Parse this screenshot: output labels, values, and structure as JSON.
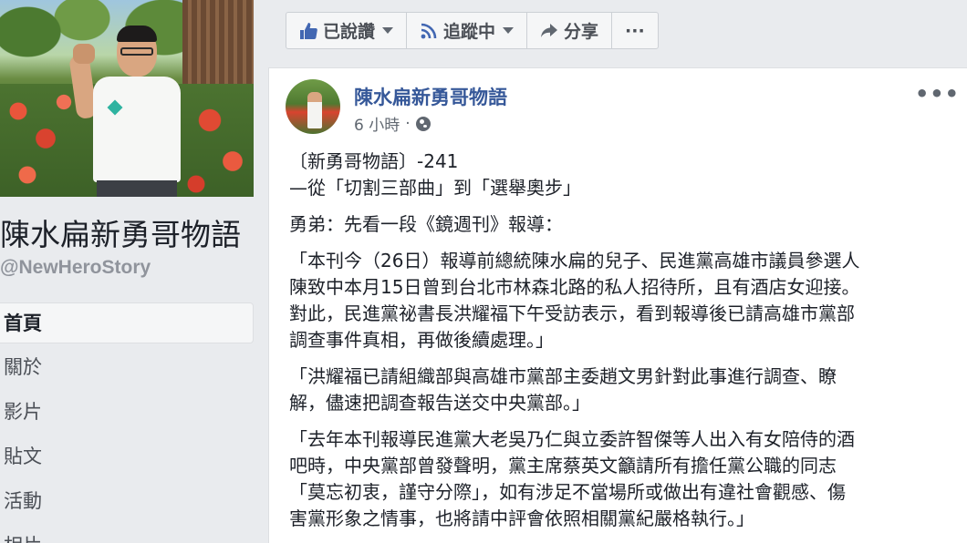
{
  "page": {
    "name": "陳水扁新勇哥物語",
    "handle": "@NewHeroStory"
  },
  "nav": {
    "items": [
      {
        "label": "首頁",
        "active": true
      },
      {
        "label": "關於",
        "active": false
      },
      {
        "label": "影片",
        "active": false
      },
      {
        "label": "貼文",
        "active": false
      },
      {
        "label": "活動",
        "active": false
      },
      {
        "label": "相片",
        "active": false
      }
    ]
  },
  "actions": {
    "liked_label": "已說讚",
    "following_label": "追蹤中",
    "share_label": "分享",
    "more_label": "···"
  },
  "post": {
    "author": "陳水扁新勇哥物語",
    "time": "6 小時",
    "separator": "·",
    "more_label": "•••",
    "lines": {
      "l1": "〔新勇哥物語〕-241",
      "l2": "—從「切割三部曲」到「選舉奧步」",
      "l3": "勇弟：先看一段《鏡週刊》報導：",
      "l4": "「本刊今（26日）報導前總統陳水扁的兒子、民進黨高雄市議員參選人",
      "l5": "陳致中本月15日曾到台北市林森北路的私人招待所，且有酒店女迎接。",
      "l6": "對此，民進黨祕書長洪耀福下午受訪表示，看到報導後已請高雄市黨部",
      "l7": "調查事件真相，再做後續處理。」",
      "l8": "「洪耀福已請組織部與高雄市黨部主委趙文男針對此事進行調查、瞭",
      "l9": "解，儘速把調查報告送交中央黨部。」",
      "l10": "「去年本刊報導民進黨大老吳乃仁與立委許智傑等人出入有女陪侍的酒",
      "l11": "吧時，中央黨部曾發聲明，黨主席蔡英文籲請所有擔任黨公職的同志",
      "l12": "「莫忘初衷，謹守分際」，如有涉足不當場所或做出有違社會觀感、傷",
      "l13": "害黨形象之情事，也將請中評會依照相關黨紀嚴格執行。」"
    }
  },
  "colors": {
    "link": "#365899",
    "background": "#e9ebee",
    "secondary_text": "#606770"
  },
  "icons": [
    "thumbs-up-icon",
    "rss-icon",
    "share-arrow-icon",
    "globe-icon",
    "more-dots-icon"
  ]
}
